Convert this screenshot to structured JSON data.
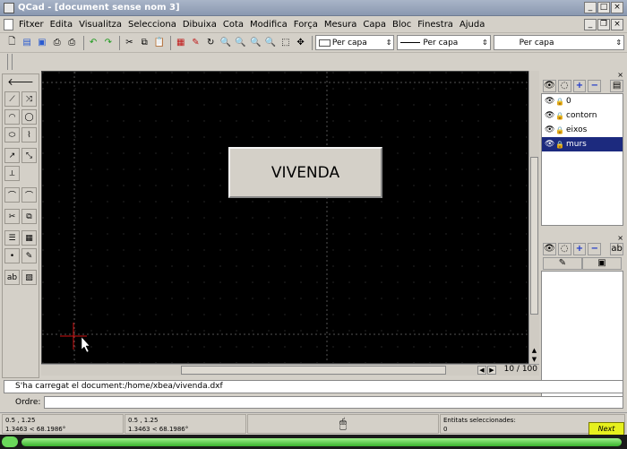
{
  "window": {
    "title": "QCad - [document sense nom 3]"
  },
  "menu": [
    "Fitxer",
    "Edita",
    "Visualitza",
    "Selecciona",
    "Dibuixa",
    "Cota",
    "Modifica",
    "Força",
    "Mesura",
    "Capa",
    "Bloc",
    "Finestra",
    "Ajuda"
  ],
  "toolbar": {
    "color_combo": "Per capa",
    "width_combo": "Per capa",
    "linetype_combo": "Per capa"
  },
  "drawing": {
    "label": "VIVENDA",
    "page_indicator": "10 / 100"
  },
  "layers": [
    {
      "name": "0",
      "selected": false
    },
    {
      "name": "contorn",
      "selected": false
    },
    {
      "name": "eixos",
      "selected": false
    },
    {
      "name": "murs",
      "selected": true
    }
  ],
  "command": {
    "message": "S'ha carregat el document:/home/xbea/vivenda.dxf",
    "prompt_label": "Ordre:",
    "prompt_value": ""
  },
  "status": {
    "abs_coord": "0.5 , 1.25",
    "abs_polar": "1.3463 < 68.1986°",
    "rel_coord": "0.5 , 1.25",
    "rel_polar": "1.3463 < 68.1986°",
    "selected_label": "Entitats seleccionades:",
    "selected_count": "0"
  },
  "taskbar": {
    "next_label": "Next"
  },
  "colors": {
    "canvas": "#000000",
    "selected_layer": "#1c2a7e",
    "crosshair": "#d01010",
    "taskbar_green": "#38b22c"
  }
}
